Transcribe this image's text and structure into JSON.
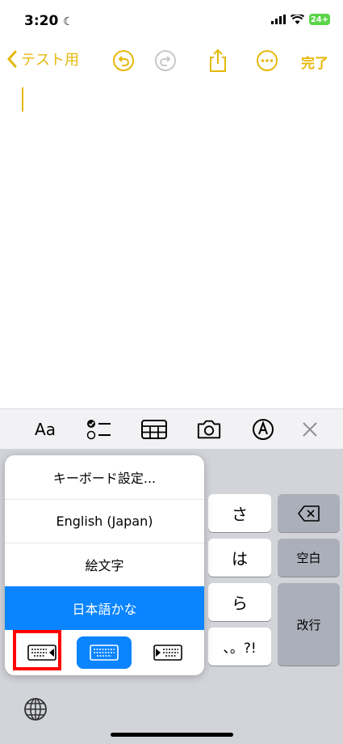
{
  "status": {
    "time": "3:20",
    "battery": "24+"
  },
  "nav": {
    "back_label": "テスト用",
    "done_label": "完了"
  },
  "toolbar": {
    "format_label": "Aa"
  },
  "popup": {
    "items": [
      "キーボード設定...",
      "English (Japan)",
      "絵文字",
      "日本語かな"
    ],
    "selected_index": 3
  },
  "keyboard": {
    "keys": {
      "sa": "さ",
      "ha": "は",
      "ra": "ら",
      "punct": "、。?!"
    },
    "space_label": "空白",
    "return_label": "改行"
  },
  "colors": {
    "accent": "#e6b80c",
    "selection": "#0a84ff",
    "highlight": "#ff0000"
  }
}
